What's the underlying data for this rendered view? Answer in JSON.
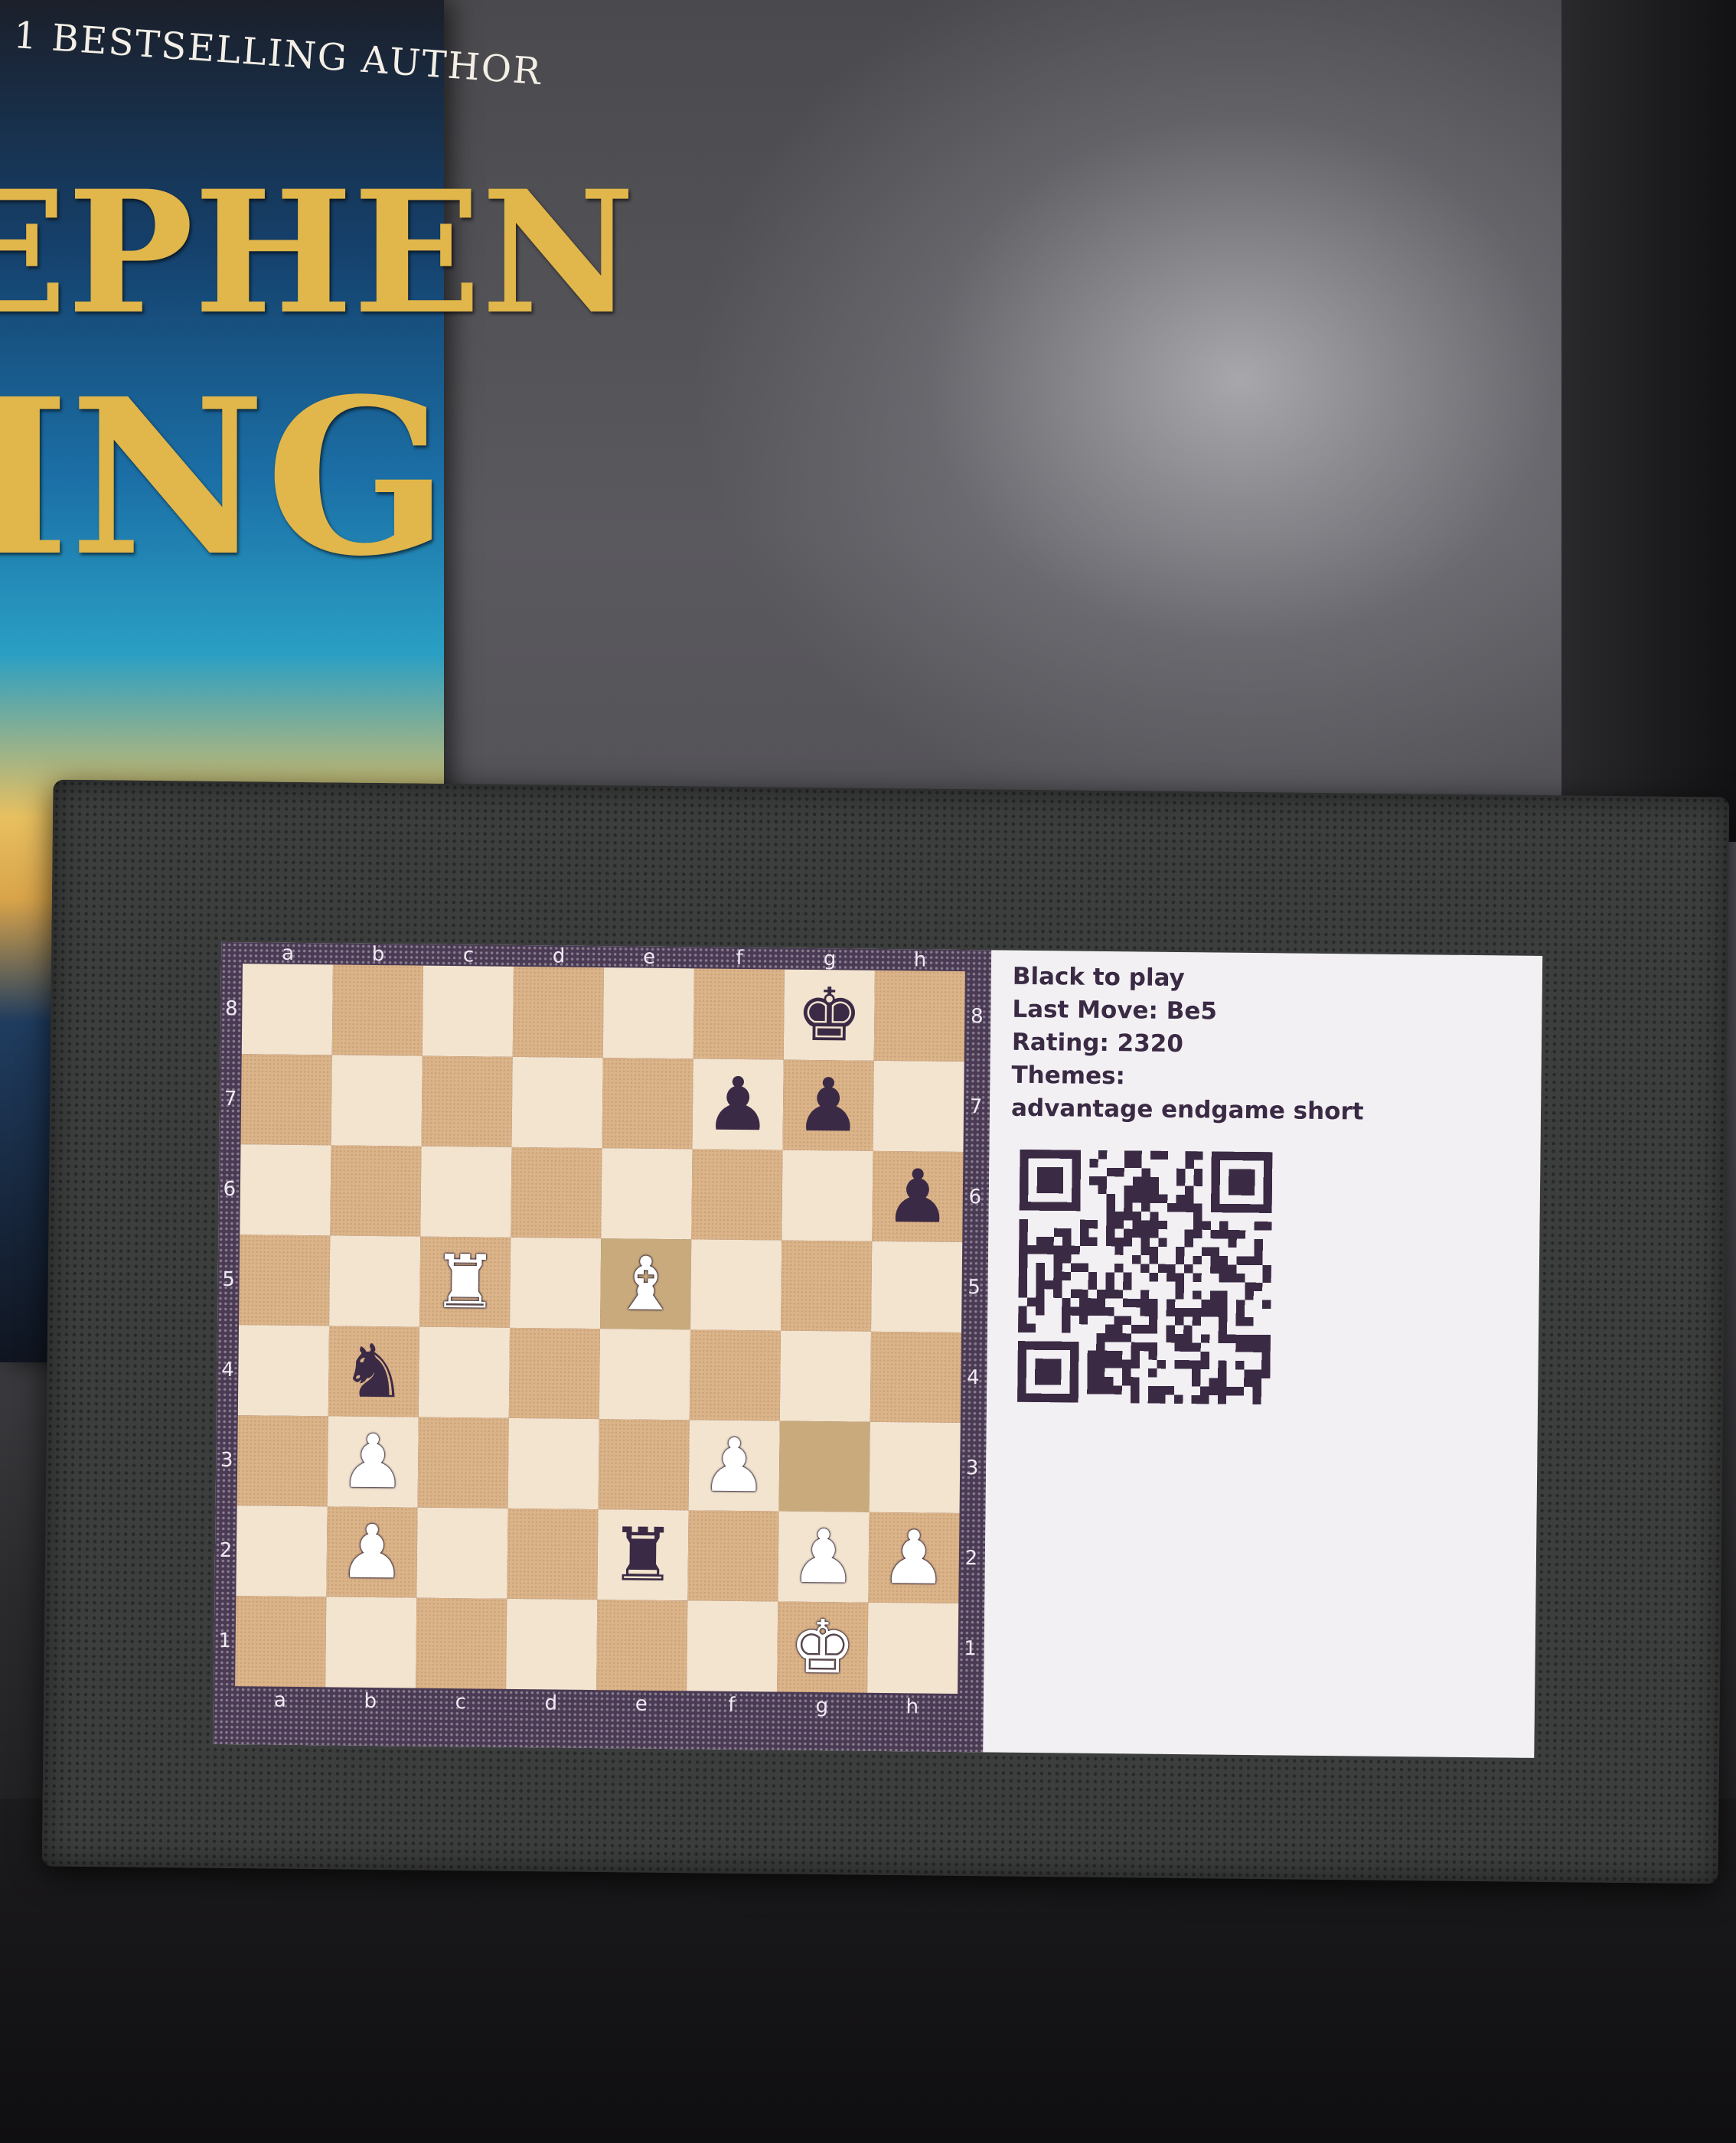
{
  "book": {
    "tagline": "1 BESTSELLING AUTHOR",
    "title_line_1": "EPHEN",
    "title_line_2": "ING"
  },
  "info": {
    "turn": "Black to play",
    "last_move": "Last Move: Be5",
    "rating": "Rating: 2320",
    "themes_label": "Themes:",
    "themes": "advantage endgame short"
  },
  "board": {
    "files": [
      "a",
      "b",
      "c",
      "d",
      "e",
      "f",
      "g",
      "h"
    ],
    "ranks": [
      "8",
      "7",
      "6",
      "5",
      "4",
      "3",
      "2",
      "1"
    ],
    "highlighted_squares": [
      "g3",
      "e5"
    ],
    "pieces": [
      {
        "square": "g8",
        "color": "b",
        "type": "king",
        "glyph": "♚"
      },
      {
        "square": "f7",
        "color": "b",
        "type": "pawn",
        "glyph": "♟"
      },
      {
        "square": "g7",
        "color": "b",
        "type": "pawn",
        "glyph": "♟"
      },
      {
        "square": "h6",
        "color": "b",
        "type": "pawn",
        "glyph": "♟"
      },
      {
        "square": "c5",
        "color": "w",
        "type": "rook",
        "glyph": "♜"
      },
      {
        "square": "e5",
        "color": "w",
        "type": "bishop",
        "glyph": "♝"
      },
      {
        "square": "b4",
        "color": "b",
        "type": "knight",
        "glyph": "♞"
      },
      {
        "square": "b3",
        "color": "w",
        "type": "pawn",
        "glyph": "♟"
      },
      {
        "square": "f3",
        "color": "w",
        "type": "pawn",
        "glyph": "♟"
      },
      {
        "square": "b2",
        "color": "w",
        "type": "pawn",
        "glyph": "♟"
      },
      {
        "square": "e2",
        "color": "b",
        "type": "rook",
        "glyph": "♜"
      },
      {
        "square": "g2",
        "color": "w",
        "type": "pawn",
        "glyph": "♟"
      },
      {
        "square": "h2",
        "color": "w",
        "type": "pawn",
        "glyph": "♟"
      },
      {
        "square": "g1",
        "color": "w",
        "type": "king",
        "glyph": "♚"
      }
    ]
  },
  "colors": {
    "light_square": "#f3e4cf",
    "dark_square": "#dcb48a",
    "highlight_square": "#c9aa7c",
    "border": "#4a3a54",
    "info_text": "#3a2a44",
    "frame": "#3c3e3d"
  },
  "qr": {
    "icon": "qr-code-icon"
  }
}
